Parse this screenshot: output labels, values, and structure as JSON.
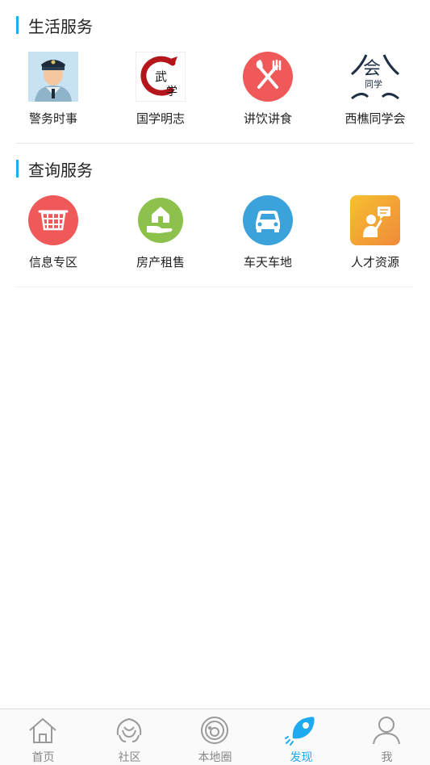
{
  "life_services": {
    "title": "生活服务",
    "items": [
      {
        "label": "警务时事",
        "icon": "police-officer-icon"
      },
      {
        "label": "国学明志",
        "icon": "guoxue-calligraphy-icon"
      },
      {
        "label": "讲饮讲食",
        "icon": "fork-knife-icon"
      },
      {
        "label": "西樵同学会",
        "icon": "alumni-association-icon"
      }
    ]
  },
  "query_services": {
    "title": "查询服务",
    "items": [
      {
        "label": "信息专区",
        "icon": "basket-icon"
      },
      {
        "label": "房产租售",
        "icon": "house-hand-icon"
      },
      {
        "label": "车天车地",
        "icon": "car-icon"
      },
      {
        "label": "人才资源",
        "icon": "talent-person-icon"
      }
    ]
  },
  "tabbar": {
    "items": [
      {
        "label": "首页",
        "icon": "home-icon"
      },
      {
        "label": "社区",
        "icon": "community-icon"
      },
      {
        "label": "本地圈",
        "icon": "local-circle-icon"
      },
      {
        "label": "发现",
        "icon": "rocket-icon"
      },
      {
        "label": "我",
        "icon": "user-icon"
      }
    ],
    "active_index": 3
  },
  "colors": {
    "accent": "#1eaaf1",
    "fork_bg": "#f0595a",
    "basket_bg": "#f0595a",
    "house_bg": "#8cc14c",
    "car_bg": "#3ca2dc",
    "talent_bg": "#f3a53a"
  }
}
